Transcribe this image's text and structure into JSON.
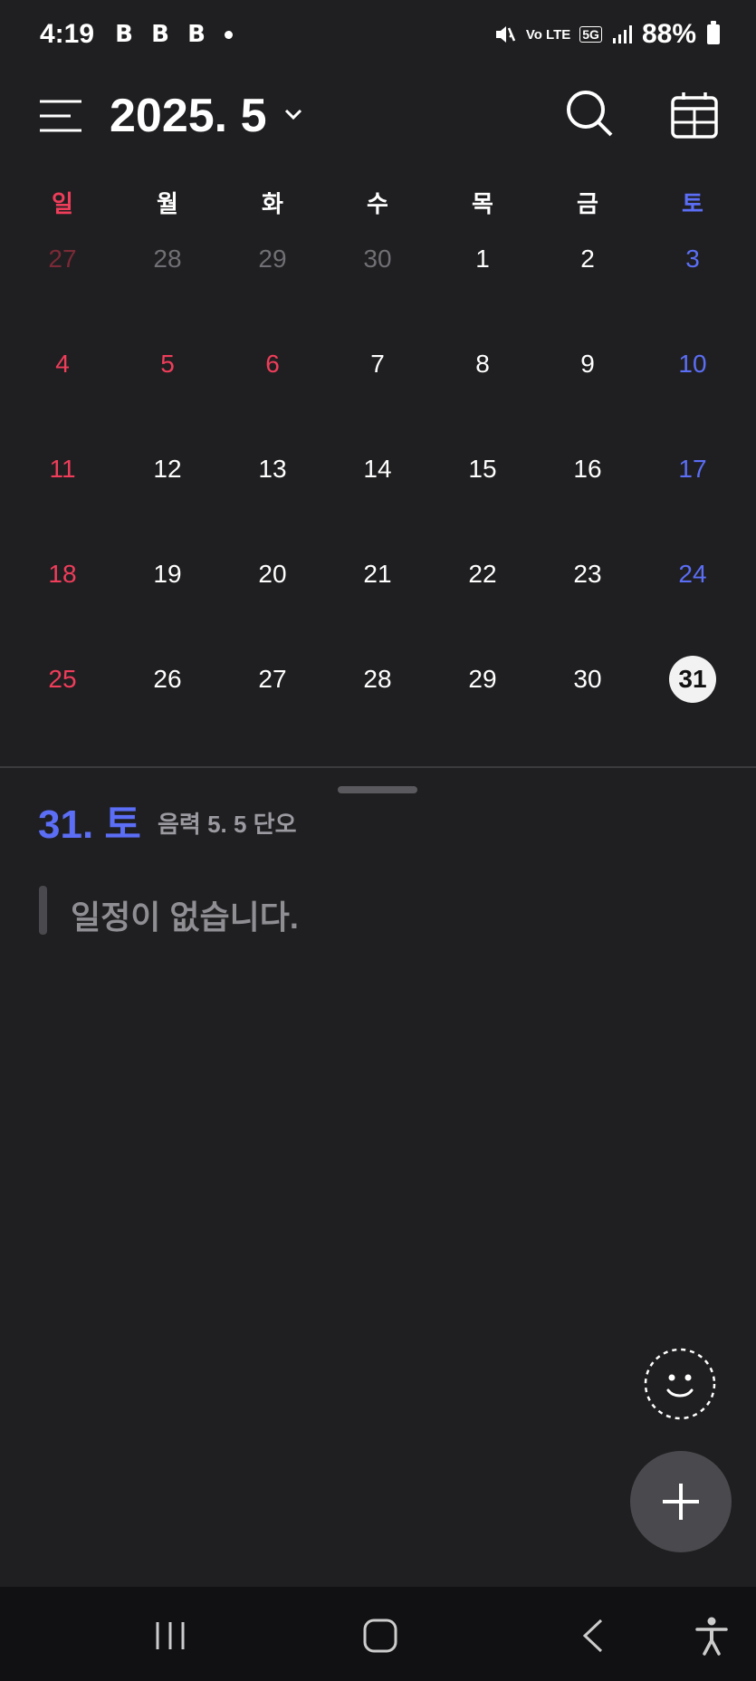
{
  "status_bar": {
    "time": "4:19",
    "app_badges": [
      "B",
      "B",
      "B"
    ],
    "network_label": "Vo LTE",
    "network_type": "5G",
    "battery": "88%"
  },
  "header": {
    "month_title": "2025. 5"
  },
  "weekdays": [
    "일",
    "월",
    "화",
    "수",
    "목",
    "금",
    "토"
  ],
  "weeks": [
    [
      "27",
      "28",
      "29",
      "30",
      "1",
      "2",
      "3"
    ],
    [
      "4",
      "5",
      "6",
      "7",
      "8",
      "9",
      "10"
    ],
    [
      "11",
      "12",
      "13",
      "14",
      "15",
      "16",
      "17"
    ],
    [
      "18",
      "19",
      "20",
      "21",
      "22",
      "23",
      "24"
    ],
    [
      "25",
      "26",
      "27",
      "28",
      "29",
      "30",
      "31"
    ]
  ],
  "colors": {
    "sunday": "#ef3d5a",
    "saturday": "#5b6ef5",
    "sunday_prev_month": "#7a2a37",
    "prev_month": "#6f6f74",
    "normal": "#ffffff"
  },
  "holidays": [
    "5",
    "6"
  ],
  "selected_day": {
    "date_label": "31. 토",
    "lunar_label": "음력  5. 5  단오"
  },
  "agenda": {
    "empty_message": "일정이 없습니다."
  }
}
